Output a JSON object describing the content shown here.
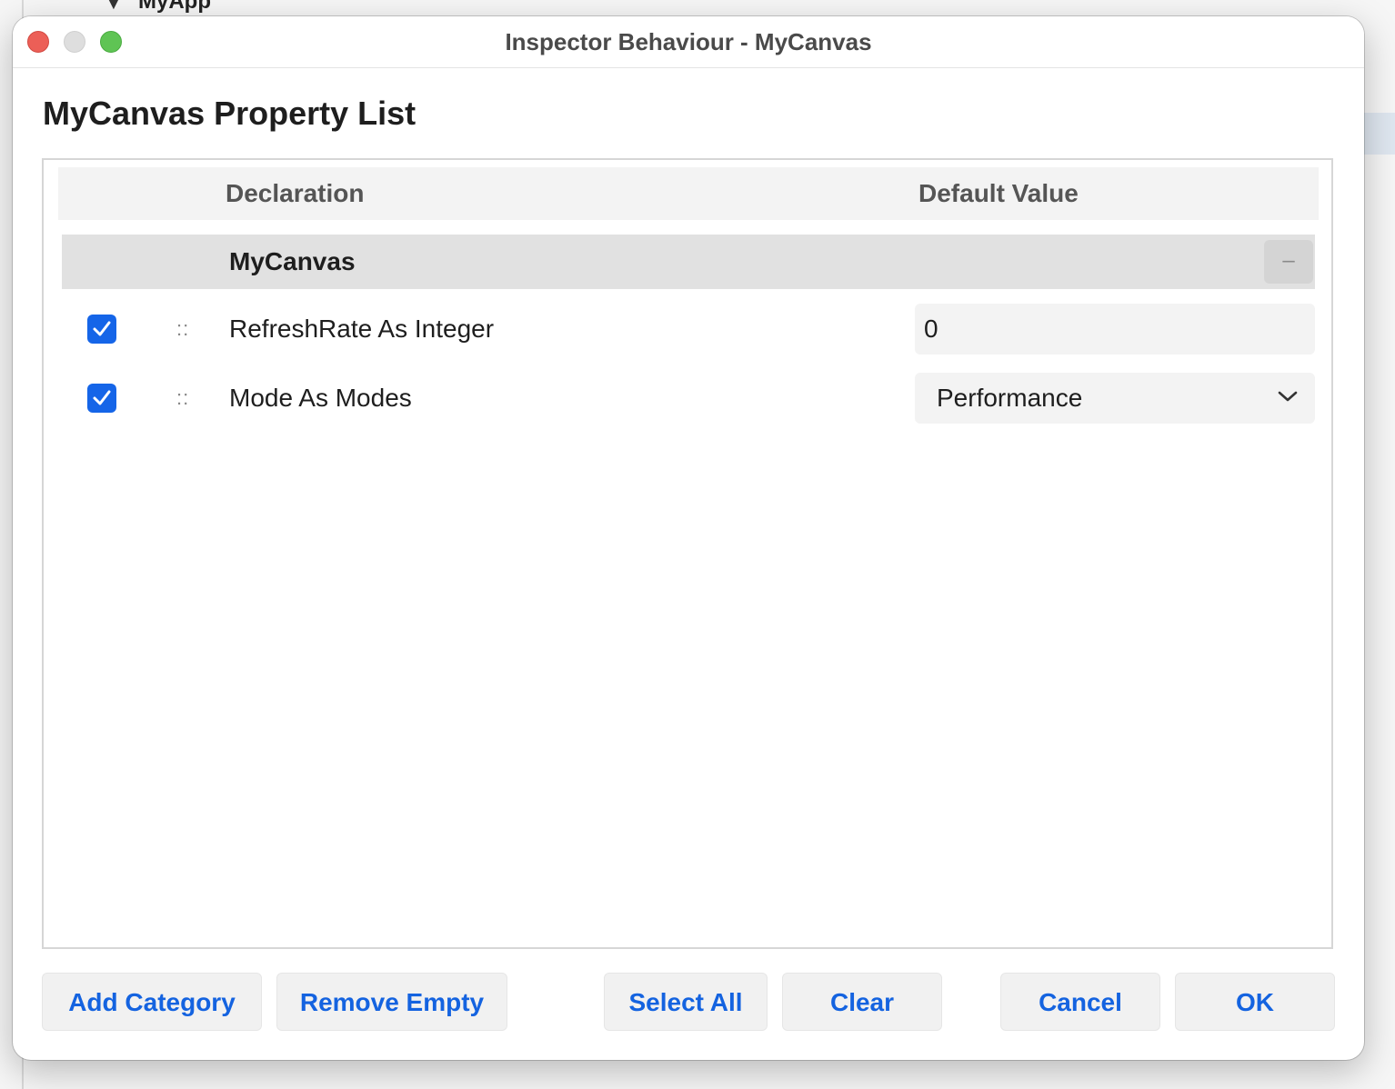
{
  "background": {
    "tree_item": "MyApp"
  },
  "window": {
    "title": "Inspector Behaviour - MyCanvas"
  },
  "page_title": "MyCanvas Property List",
  "table": {
    "columns": [
      "Declaration",
      "Default Value"
    ],
    "category": {
      "name": "MyCanvas",
      "collapse_label": "–"
    },
    "rows": [
      {
        "checked": true,
        "handle": "::",
        "declaration": "RefreshRate As Integer",
        "value": "0",
        "value_type": "text"
      },
      {
        "checked": true,
        "handle": "::",
        "declaration": "Mode As Modes",
        "value": "Performance",
        "value_type": "select"
      }
    ]
  },
  "buttons": {
    "add_category": "Add Category",
    "remove_empty": "Remove Empty",
    "select_all": "Select All",
    "clear": "Clear",
    "cancel": "Cancel",
    "ok": "OK"
  },
  "colors": {
    "accent": "#1463e0",
    "checkbox": "#1565e8",
    "close": "#ec5f57",
    "minimize": "#dedede",
    "maximize": "#5fc454"
  }
}
